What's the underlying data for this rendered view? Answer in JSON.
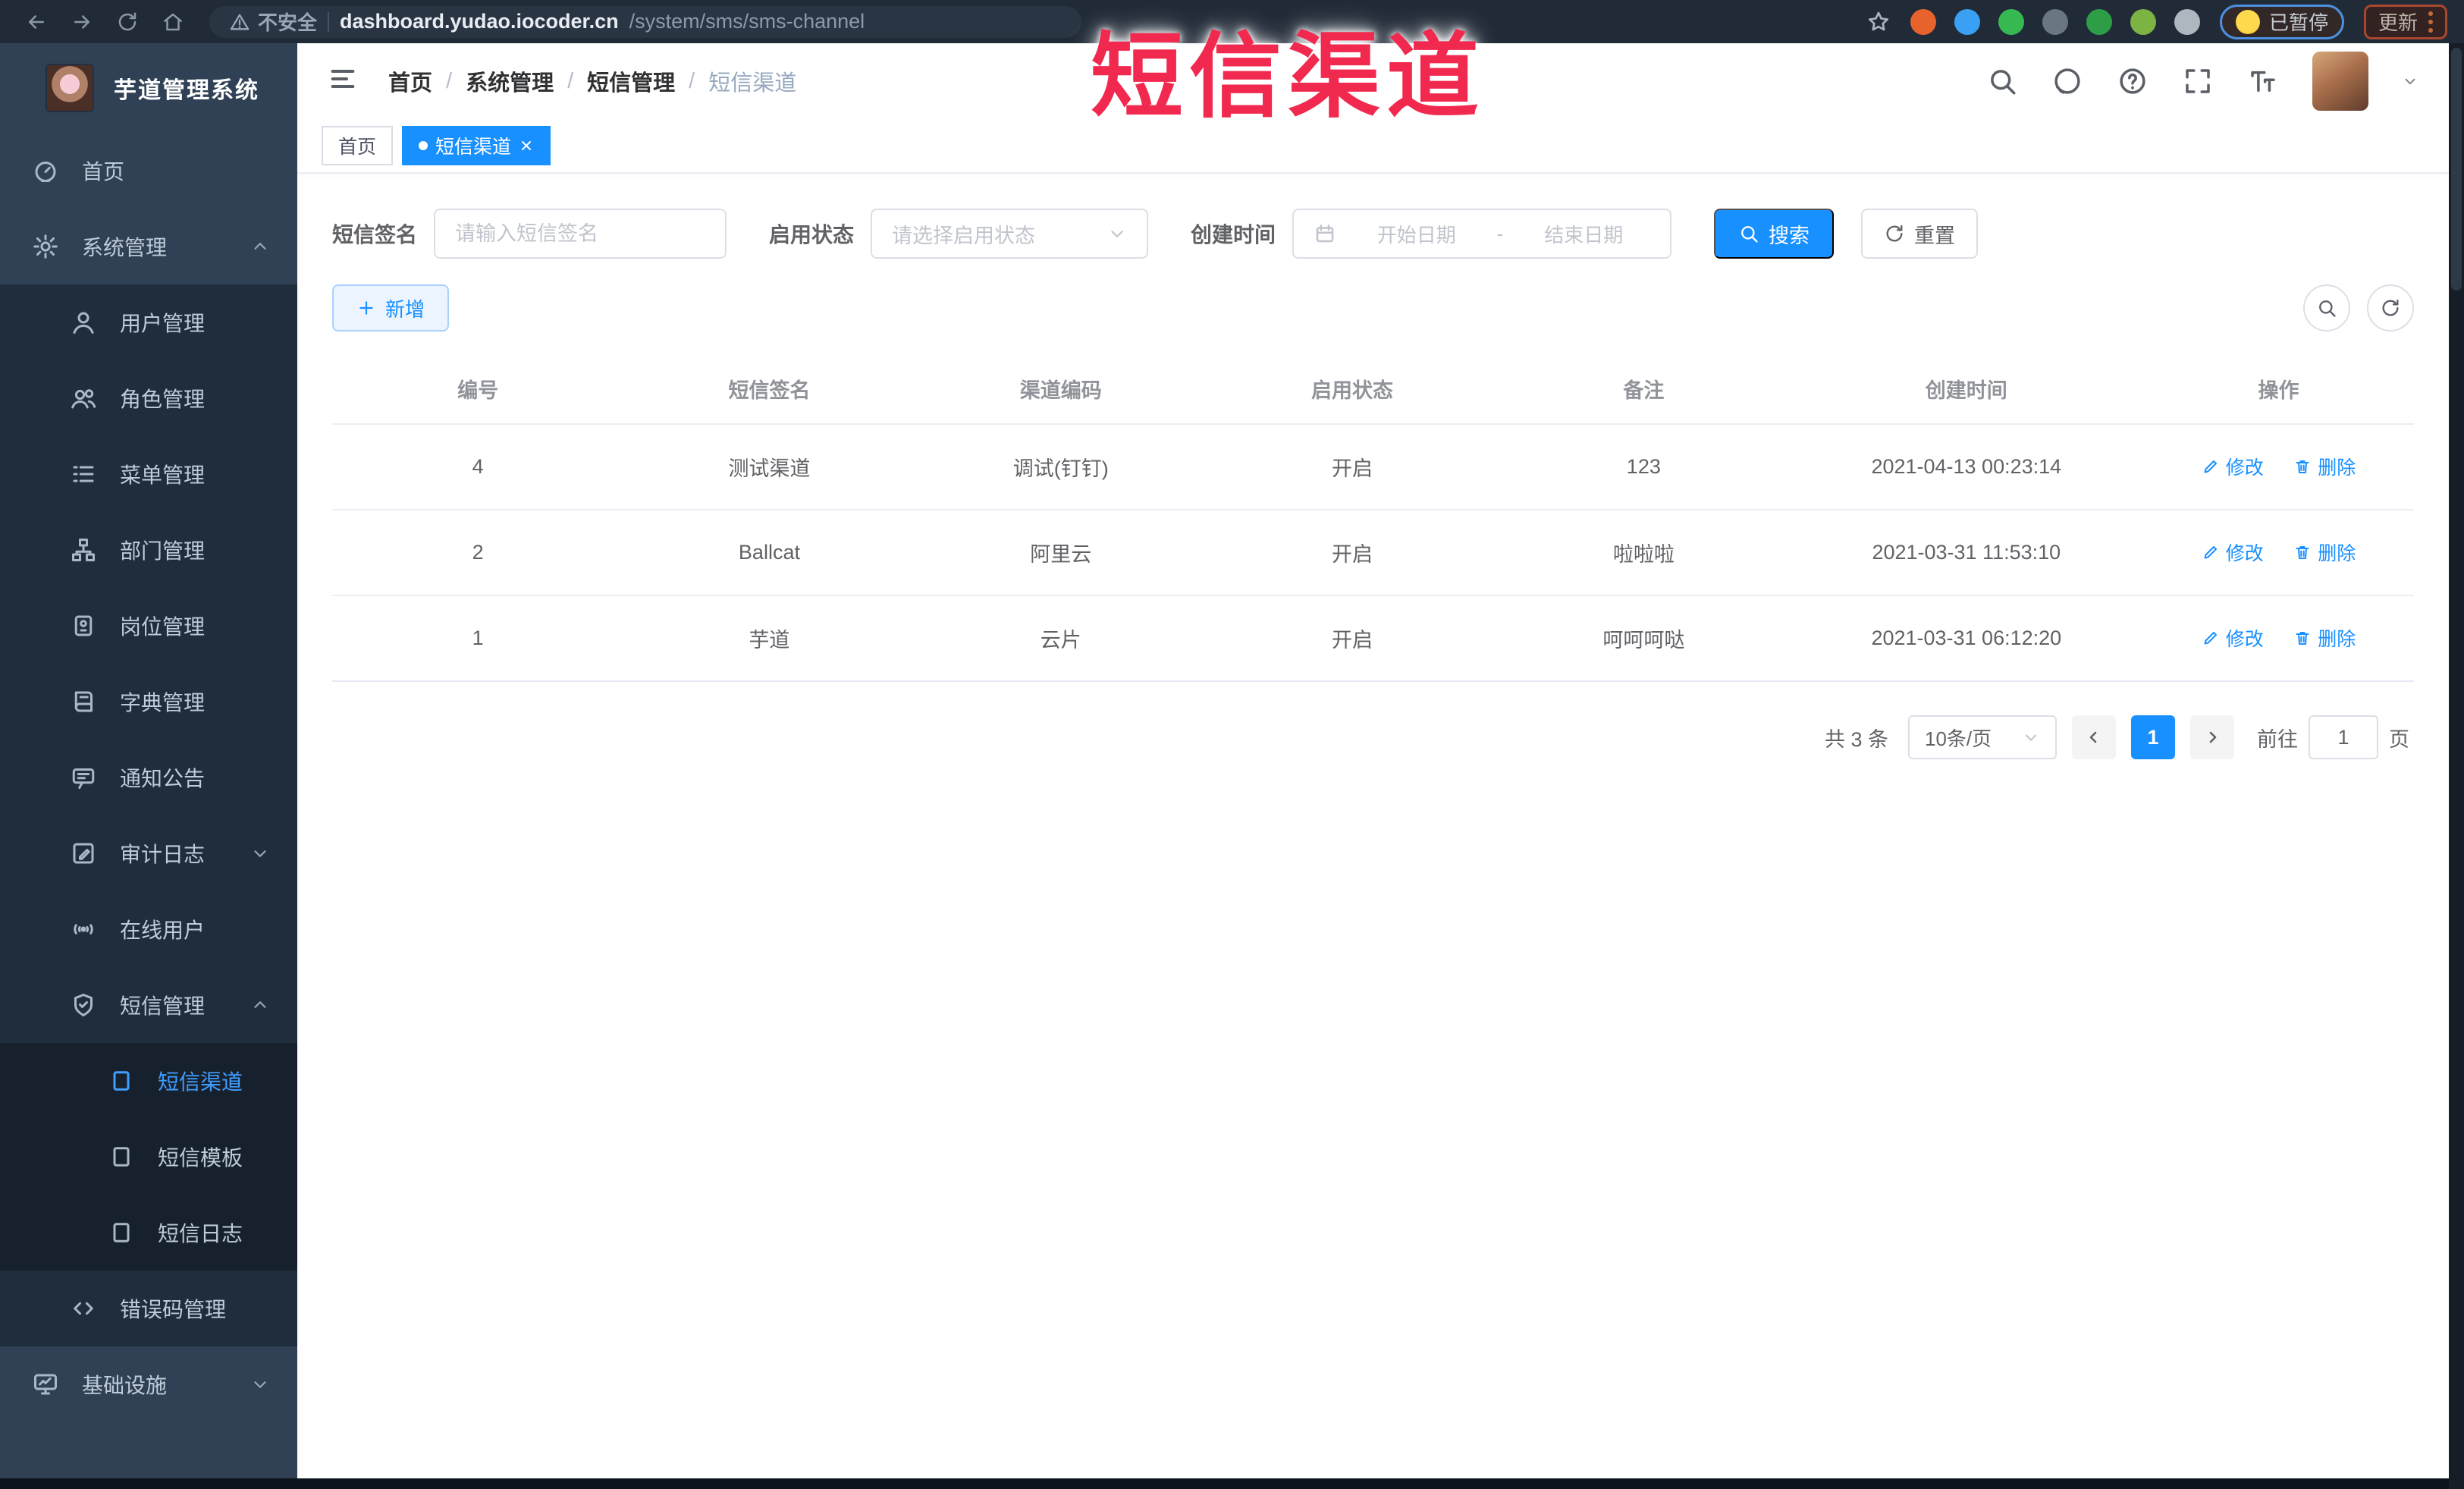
{
  "colors": {
    "accent": "#1890ff",
    "sidebar_bg": "#304156",
    "submenu_bg": "#1f2d3d",
    "subsubmenu_bg": "#17212e",
    "sidebar_text": "#bfcbd9",
    "active_text": "#409eff",
    "watermark_red": "#f2294f"
  },
  "browser": {
    "nav_icons": [
      "back-icon",
      "forward-icon",
      "reload-icon",
      "home-icon"
    ],
    "security_label": "不安全",
    "url_host": "dashboard.yudao.iocoder.cn",
    "url_path": "/system/sms/sms-channel",
    "bookmark_icon": "star-icon",
    "extension_icons": [
      {
        "icon": "orange-circle-extension-icon",
        "color": "#e8622c"
      },
      {
        "icon": "blue-pin-extension-icon",
        "color": "#3aa0f3"
      },
      {
        "icon": "green-check-extension-icon",
        "color": "#35b950"
      },
      {
        "icon": "grid-extension-icon",
        "color": "#6b7683"
      },
      {
        "icon": "vpn-on-extension-icon",
        "color": "#2e9e46"
      },
      {
        "icon": "green-leaf-extension-icon",
        "color": "#7cb342"
      },
      {
        "icon": "puzzle-extension-icon",
        "color": "#aeb6bf"
      }
    ],
    "paused_badge": "已暂停",
    "update_button": "更新"
  },
  "watermark": "短信渠道",
  "sidebar": {
    "logo_icon": "rabbit-logo",
    "title": "芋道管理系统",
    "items": [
      {
        "label": "首页",
        "icon": "dashboard",
        "level": "top"
      },
      {
        "label": "系统管理",
        "icon": "gear",
        "level": "top",
        "expand": "up"
      },
      {
        "label": "用户管理",
        "icon": "user",
        "level": "sub"
      },
      {
        "label": "角色管理",
        "icon": "users",
        "level": "sub"
      },
      {
        "label": "菜单管理",
        "icon": "menu-list",
        "level": "sub"
      },
      {
        "label": "部门管理",
        "icon": "org-tree",
        "level": "sub"
      },
      {
        "label": "岗位管理",
        "icon": "badge",
        "level": "sub"
      },
      {
        "label": "字典管理",
        "icon": "dict-book",
        "level": "sub"
      },
      {
        "label": "通知公告",
        "icon": "notice-message",
        "level": "sub"
      },
      {
        "label": "审计日志",
        "icon": "log-edit",
        "level": "sub",
        "expand": "down"
      },
      {
        "label": "在线用户",
        "icon": "online-signal",
        "level": "sub"
      },
      {
        "label": "短信管理",
        "icon": "sms-shield",
        "level": "sub",
        "expand": "up"
      },
      {
        "label": "短信渠道",
        "icon": "doc-square",
        "level": "subsub",
        "active": true
      },
      {
        "label": "短信模板",
        "icon": "doc-square",
        "level": "subsub"
      },
      {
        "label": "短信日志",
        "icon": "doc-square",
        "level": "subsub"
      },
      {
        "label": "错误码管理",
        "icon": "code-brackets",
        "level": "sub"
      },
      {
        "label": "基础设施",
        "icon": "monitor",
        "level": "top",
        "expand": "down"
      }
    ]
  },
  "header": {
    "menu_toggle_icon": "hamburger-icon",
    "breadcrumb": [
      "首页",
      "系统管理",
      "短信管理",
      "短信渠道"
    ],
    "right_icons": [
      "search-icon",
      "github-icon",
      "help-icon",
      "fullscreen-icon",
      "font-size-icon"
    ],
    "avatar_icon": "user-avatar",
    "avatar_caret_icon": "chevron-down-icon"
  },
  "tabs": [
    {
      "label": "首页",
      "active": false,
      "closable": false
    },
    {
      "label": "短信渠道",
      "active": true,
      "closable": true
    }
  ],
  "form": {
    "signature_label": "短信签名",
    "signature_placeholder": "请输入短信签名",
    "status_label": "启用状态",
    "status_placeholder": "请选择启用状态",
    "time_label": "创建时间",
    "date_start_placeholder": "开始日期",
    "date_separator": "-",
    "date_end_placeholder": "结束日期",
    "search_button": "搜索",
    "reset_button": "重置"
  },
  "toolbar": {
    "add_button": "新增",
    "tool_icons": [
      "search-circle-icon",
      "refresh-circle-icon"
    ]
  },
  "table": {
    "columns": [
      "编号",
      "短信签名",
      "渠道编码",
      "启用状态",
      "备注",
      "创建时间",
      "操作"
    ],
    "rows": [
      {
        "id": "4",
        "signature": "测试渠道",
        "code": "调试(钉钉)",
        "status": "开启",
        "remark": "123",
        "created": "2021-04-13 00:23:14"
      },
      {
        "id": "2",
        "signature": "Ballcat",
        "code": "阿里云",
        "status": "开启",
        "remark": "啦啦啦",
        "created": "2021-03-31 11:53:10"
      },
      {
        "id": "1",
        "signature": "芋道",
        "code": "云片",
        "status": "开启",
        "remark": "呵呵呵哒",
        "created": "2021-03-31 06:12:20"
      }
    ],
    "actions": {
      "edit": "修改",
      "delete": "删除"
    }
  },
  "pagination": {
    "total_label": "共 3 条",
    "page_size": "10条/页",
    "current_page": "1",
    "goto_label": "前往",
    "goto_value": "1",
    "page_suffix": "页"
  }
}
